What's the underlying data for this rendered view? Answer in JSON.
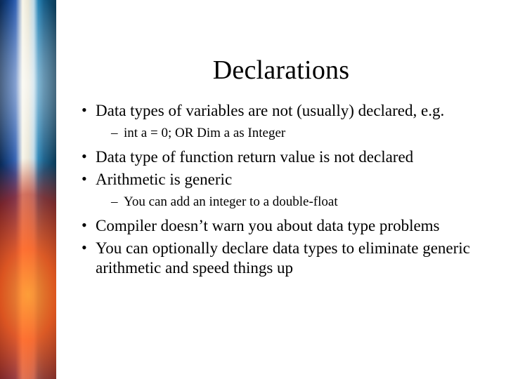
{
  "title": "Declarations",
  "bullets": {
    "b1": "Data types of variables are not (usually) declared, e.g.",
    "b1_sub1": "int a = 0; OR Dim a as Integer",
    "b2": "Data type of function return value is not declared",
    "b3": "Arithmetic is generic",
    "b3_sub1": "You can add an integer to a double-float",
    "b4": "Compiler doesn’t warn you about data type problems",
    "b5": "You can optionally declare data types to eliminate generic arithmetic and speed things up"
  }
}
